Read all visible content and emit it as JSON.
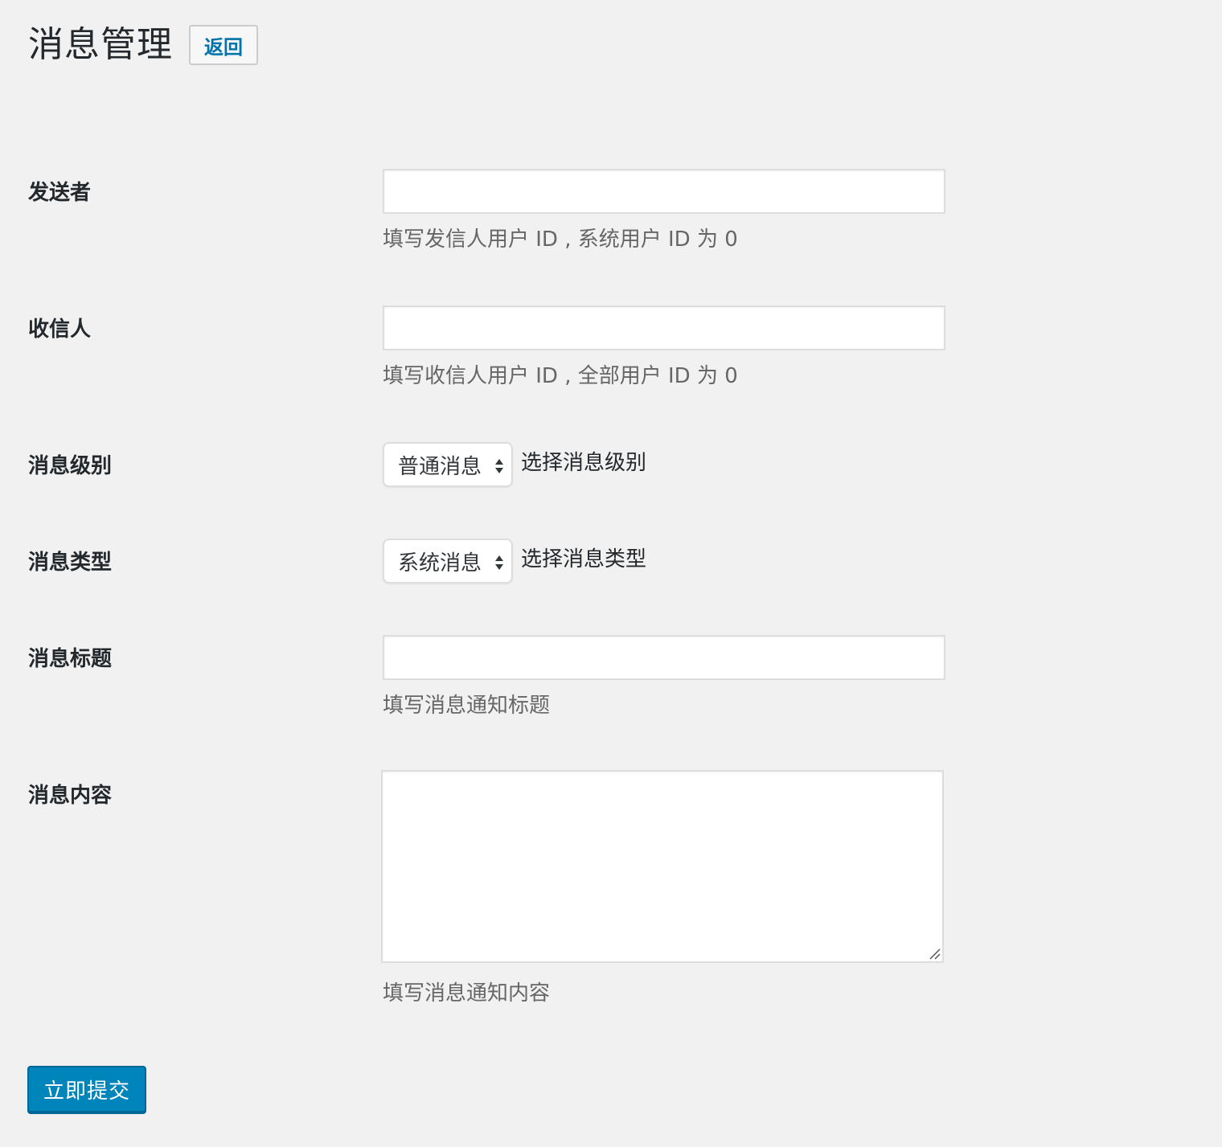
{
  "header": {
    "title": "消息管理",
    "back_label": "返回"
  },
  "form": {
    "sender": {
      "label": "发送者",
      "value": "",
      "description": "填写发信人用户 ID , 系统用户 ID 为 0"
    },
    "recipient": {
      "label": "收信人",
      "value": "",
      "description": "填写收信人用户 ID , 全部用户 ID 为 0"
    },
    "level": {
      "label": "消息级别",
      "selected": "普通消息",
      "hint": "选择消息级别"
    },
    "type": {
      "label": "消息类型",
      "selected": "系统消息",
      "hint": "选择消息类型"
    },
    "title": {
      "label": "消息标题",
      "value": "",
      "description": "填写消息通知标题"
    },
    "content": {
      "label": "消息内容",
      "value": "",
      "description": "填写消息通知内容"
    },
    "submit_label": "立即提交"
  },
  "colors": {
    "background": "#f1f1f1",
    "primary_button": "#0085ba",
    "link": "#0073aa",
    "text": "#23282d",
    "muted_text": "#666666"
  },
  "icons": {
    "select_arrows": "sort-arrows-icon",
    "resize_handle": "resize-handle-icon"
  }
}
